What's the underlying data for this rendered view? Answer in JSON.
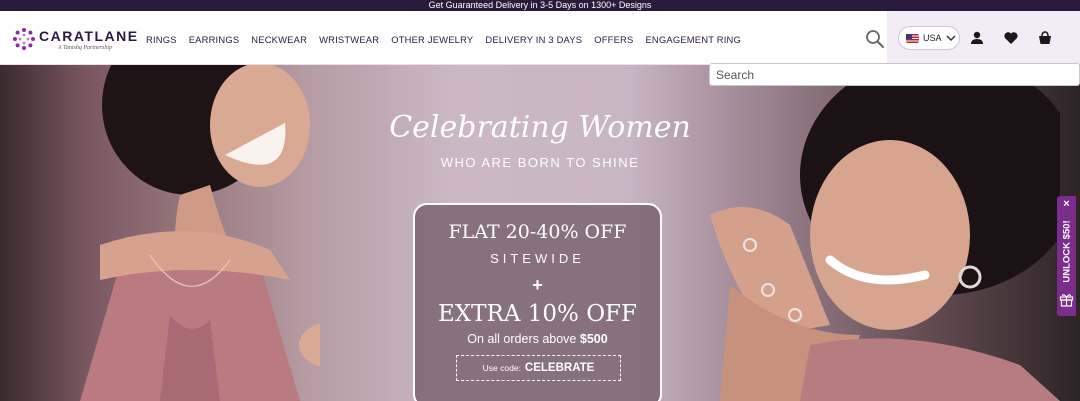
{
  "announcement": "Get Guaranteed Delivery in 3-5 Days on 1300+ Designs",
  "brand": {
    "name": "CARATLANE",
    "tagline": "A Tanishq Partnership"
  },
  "nav": {
    "items": [
      {
        "label": "RINGS"
      },
      {
        "label": "EARRINGS"
      },
      {
        "label": "NECKWEAR"
      },
      {
        "label": "WRISTWEAR"
      },
      {
        "label": "OTHER JEWELRY"
      },
      {
        "label": "DELIVERY IN 3 DAYS"
      },
      {
        "label": "OFFERS"
      },
      {
        "label": "ENGAGEMENT RING"
      }
    ]
  },
  "country": {
    "label": "USA"
  },
  "search": {
    "placeholder": "Search",
    "value": ""
  },
  "hero": {
    "title": "Celebrating Women",
    "subtitle": "WHO ARE BORN TO SHINE",
    "offer_line1": "FLAT 20-40% OFF",
    "offer_line2": "SITEWIDE",
    "plus": "+",
    "offer_line3": "EXTRA 10% OFF",
    "offer_line4_prefix": "On all orders above",
    "offer_line4_amount": "$500",
    "code_label": "Use code:",
    "code_value": "CELEBRATE"
  },
  "unlock_tab": {
    "close": "×",
    "label": "UNLOCK $50!"
  },
  "colors": {
    "brand": "#2b1a3f",
    "announcement_bg": "#2a1a3e",
    "accent_purple": "#7a2d8c",
    "icon_zone_bg": "#f1ecf6"
  },
  "icons": [
    "logo-mark-icon",
    "search-icon",
    "us-flag-icon",
    "chevron-down-icon",
    "user-icon",
    "heart-icon",
    "cart-icon",
    "close-icon",
    "gift-icon"
  ]
}
